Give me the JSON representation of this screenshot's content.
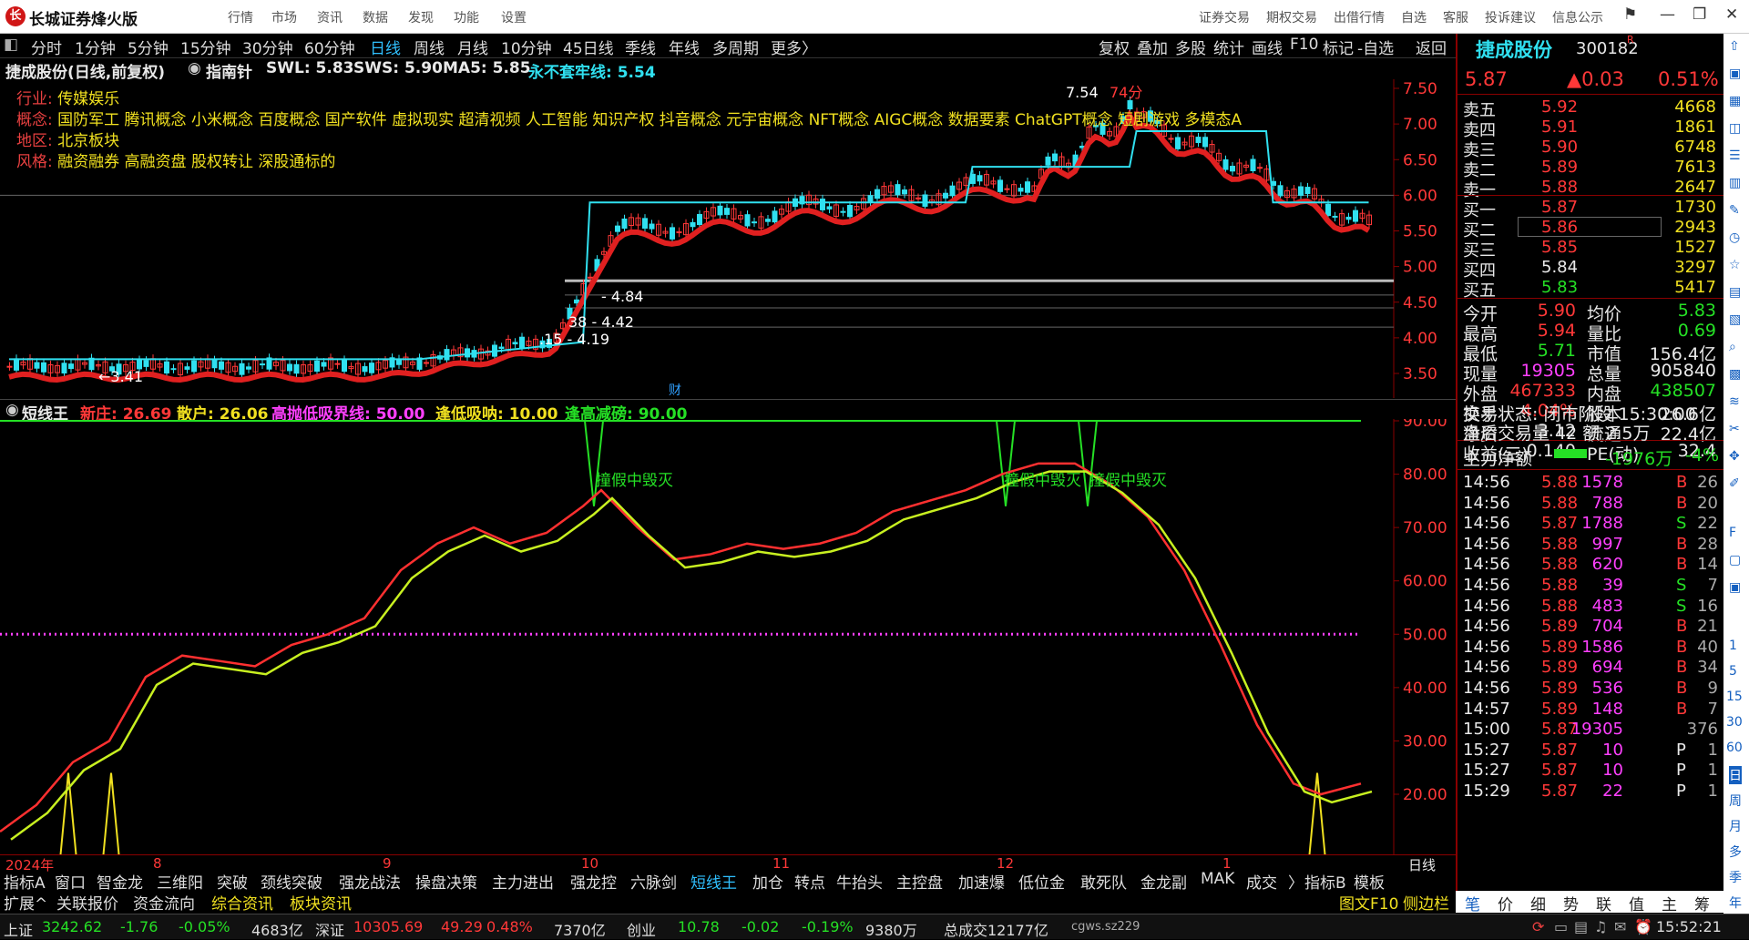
{
  "app": {
    "title": "长城证券烽火版",
    "logo_text": "长"
  },
  "top_menu": [
    "行情",
    "市场",
    "资讯",
    "数据",
    "发现",
    "功能",
    "设置"
  ],
  "top_right_menu": [
    "证券交易",
    "期权交易",
    "出借行情",
    "自选",
    "客服",
    "投诉建议",
    "信息公示"
  ],
  "period_tabs": [
    "分时",
    "1分钟",
    "5分钟",
    "15分钟",
    "30分钟",
    "60分钟",
    "日线",
    "周线",
    "月线",
    "10分钟",
    "45日线",
    "季线",
    "年线",
    "多周期",
    "更多〉"
  ],
  "period_active": "日线",
  "chart_toolbar": [
    "复权",
    "叠加",
    "多股",
    "统计",
    "画线",
    "F10",
    "标记",
    "-自选",
    "返回"
  ],
  "main_chart": {
    "stock_title": "捷成股份(日线,前复权)",
    "indicator_name": "指南针",
    "swl": "SWL: 5.83",
    "sws": "SWS: 5.90",
    "ma5": "MA5: 5.85",
    "line_label": "永不套牢线: 5.54",
    "tags": {
      "industry_key": "行业:",
      "industry_val": "传媒娱乐",
      "concept_key": "概念:",
      "concept_val": "国防军工 腾讯概念 小米概念 百度概念 国产软件 虚拟现实 超清视频 人工智能 知识产权 抖音概念 元宇宙概念 NFT概念 AIGC概念 数据要素 ChatGPT概念 短剧游戏 多模态A",
      "region_key": "地区:",
      "region_val": "北京板块",
      "style_key": "风格:",
      "style_val": "融资融券 高融资盘 股权转让 深股通标的"
    },
    "annotations": {
      "high": "7.54",
      "score": "74分",
      "low": "←3.41",
      "s1": "- 4.84",
      "s2": "38 - 4.42",
      "s3": ".15 - 4.19",
      "cai": "财"
    },
    "y_ticks": [
      "7.50",
      "7.00",
      "6.50",
      "6.00",
      "5.50",
      "5.00",
      "4.50",
      "4.00",
      "3.50"
    ]
  },
  "sub_chart": {
    "name": "短线王",
    "new_zhuang": "新庄: 26.69",
    "sanhu": "散户: 26.06",
    "boundary": "高抛低吸界线: 50.00",
    "low_buy": "逢低吸呐: 10.00",
    "high_sell": "逢高减磅: 90.00",
    "annotation": "撞假中毁灭",
    "y_ticks": [
      "90.00",
      "80.00",
      "70.00",
      "60.00",
      "50.00",
      "40.00",
      "30.00",
      "20.00"
    ]
  },
  "x_axis": {
    "labels": [
      "2024年",
      "8",
      "9",
      "10",
      "11",
      "12",
      "1"
    ],
    "period_label": "日线"
  },
  "indicator_tabs": [
    "指标A",
    "窗口",
    "智金龙",
    "三维阳",
    "突破",
    "颈线突破",
    "强龙战法",
    "操盘决策",
    "主力进出",
    "强龙控",
    "六脉剑",
    "短线王",
    "加仓",
    "转点",
    "牛抬头",
    "主控盘",
    "加速爆",
    "低位金",
    "敢死队",
    "金龙副",
    "MAK",
    "成交",
    "〉",
    "指标B",
    "模板"
  ],
  "indicator_active": "短线王",
  "bottom_tabs": [
    "扩展^",
    "关联报价",
    "资金流向",
    "综合资讯",
    "板块资讯"
  ],
  "quote": {
    "name": "捷成股份",
    "code": "300182",
    "badge": "R",
    "price": "5.87",
    "change": "▲0.03",
    "pct": "0.51%",
    "asks": [
      {
        "label": "卖五",
        "price": "5.92",
        "vol": "4668"
      },
      {
        "label": "卖四",
        "price": "5.91",
        "vol": "1861"
      },
      {
        "label": "卖三",
        "price": "5.90",
        "vol": "6748"
      },
      {
        "label": "卖二",
        "price": "5.89",
        "vol": "7613"
      },
      {
        "label": "卖一",
        "price": "5.88",
        "vol": "2647"
      }
    ],
    "bids": [
      {
        "label": "买一",
        "price": "5.87",
        "vol": "1730"
      },
      {
        "label": "买二",
        "price": "5.86",
        "vol": "2943"
      },
      {
        "label": "买三",
        "price": "5.85",
        "vol": "1527"
      },
      {
        "label": "买四",
        "price": "5.84",
        "vol": "3297"
      },
      {
        "label": "买五",
        "price": "5.83",
        "vol": "5417"
      }
    ],
    "stats": [
      {
        "k1": "今开",
        "v1": "5.90",
        "k2": "均价",
        "v2": "5.83"
      },
      {
        "k1": "最高",
        "v1": "5.94",
        "k2": "量比",
        "v2": "0.69"
      },
      {
        "k1": "最低",
        "v1": "5.71",
        "k2": "市值",
        "v2": "156.4亿"
      },
      {
        "k1": "现量",
        "v1": "19305",
        "k2": "总量",
        "v2": "905840"
      },
      {
        "k1": "外盘",
        "v1": "467333",
        "k2": "内盘",
        "v2": "438507"
      },
      {
        "k1": "换手",
        "v1": "4.04%",
        "k2": "股本",
        "v2": "26.6亿"
      },
      {
        "k1": "净资",
        "v1": "3.12",
        "k2": "流通",
        "v2": "22.4亿"
      },
      {
        "k1": "收益(三)",
        "v1": "0.140",
        "k2": "PE(动)",
        "v2": "32.4"
      }
    ],
    "trade_state": "交易状态: 闭市阶段 15:30:00",
    "after_hours": "盘后交易量 42 额 2.5万",
    "main_net_label": "主力净额",
    "main_net_value": "-1976万",
    "main_net_pct": "-4%"
  },
  "ticks": [
    {
      "t": "14:56",
      "p": "5.88",
      "v": "1578",
      "d": "B",
      "n": "26"
    },
    {
      "t": "14:56",
      "p": "5.88",
      "v": "788",
      "d": "B",
      "n": "20"
    },
    {
      "t": "14:56",
      "p": "5.87",
      "v": "1788",
      "d": "S",
      "n": "22"
    },
    {
      "t": "14:56",
      "p": "5.88",
      "v": "997",
      "d": "B",
      "n": "28"
    },
    {
      "t": "14:56",
      "p": "5.88",
      "v": "620",
      "d": "B",
      "n": "14"
    },
    {
      "t": "14:56",
      "p": "5.88",
      "v": "39",
      "d": "S",
      "n": "7"
    },
    {
      "t": "14:56",
      "p": "5.88",
      "v": "483",
      "d": "S",
      "n": "16"
    },
    {
      "t": "14:56",
      "p": "5.89",
      "v": "704",
      "d": "B",
      "n": "21"
    },
    {
      "t": "14:56",
      "p": "5.89",
      "v": "1586",
      "d": "B",
      "n": "40"
    },
    {
      "t": "14:56",
      "p": "5.89",
      "v": "694",
      "d": "B",
      "n": "34"
    },
    {
      "t": "14:56",
      "p": "5.89",
      "v": "536",
      "d": "B",
      "n": "9"
    },
    {
      "t": "14:57",
      "p": "5.89",
      "v": "148",
      "d": "B",
      "n": "7"
    },
    {
      "t": "15:00",
      "p": "5.87",
      "v": "19305",
      "d": "",
      "n": "376"
    },
    {
      "t": "15:27",
      "p": "5.87",
      "v": "10",
      "d": "P",
      "n": "1"
    },
    {
      "t": "15:27",
      "p": "5.87",
      "v": "10",
      "d": "P",
      "n": "1"
    },
    {
      "t": "15:29",
      "p": "5.87",
      "v": "22",
      "d": "P",
      "n": "1"
    }
  ],
  "right_bottom_tabs": [
    "笔",
    "价",
    "细",
    "势",
    "联",
    "值",
    "主",
    "筹"
  ],
  "side_tabs": [
    "1",
    "5",
    "15",
    "30",
    "60",
    "日",
    "周",
    "月",
    "多",
    "季",
    "年"
  ],
  "statusbar": {
    "sh_name": "上证",
    "sh_val": "3242.62",
    "sh_chg": "-1.76",
    "sh_pct": "-0.05%",
    "sh_amt": "4683亿",
    "sz_name": "深证",
    "sz_val": "10305.69",
    "sz_chg": "49.29",
    "sz_pct": "0.48%",
    "sz_amt": "7370亿",
    "cy_name": "创业",
    "cy_val": "10.78",
    "cy_chg": "-0.02",
    "cy_pct": "-0.19%",
    "cy_amt": "9380万",
    "total": "总成交12177亿",
    "server": "cgws.sz229",
    "extra": "图文F10",
    "side": "侧边栏",
    "time": "15:52:21"
  },
  "colors": {
    "up": "#ff3838",
    "down": "#25e025",
    "cyan": "#30e0f0",
    "yellow": "#f0e020",
    "magenta": "#ff40ff",
    "panelborder": "#8a0000"
  }
}
